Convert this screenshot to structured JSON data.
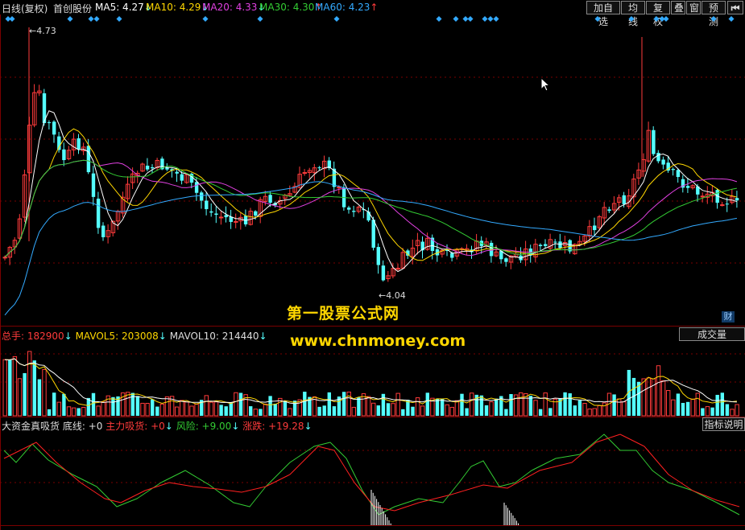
{
  "header": {
    "period": "日线(复权)",
    "stock_name": "首创股份",
    "ma": [
      {
        "label": "MA5: 4.27",
        "arrow": "↓",
        "color": "#ffffff"
      },
      {
        "label": "MA10: 4.29",
        "arrow": "↓",
        "color": "#ffd700"
      },
      {
        "label": "MA20: 4.33",
        "arrow": "↓",
        "color": "#e040e0"
      },
      {
        "label": "MA30: 4.30",
        "arrow": "↑",
        "color": "#33cc33"
      },
      {
        "label": "MA60: 4.23",
        "arrow": "↑",
        "color": "#33aaff"
      }
    ],
    "buttons": [
      "加自选",
      "均线",
      "复权",
      "叠",
      "窗",
      "预测"
    ],
    "nav_icon": "skip-back-icon"
  },
  "price": {
    "high_label": "4.73",
    "low_label": "4.04",
    "badge": "财"
  },
  "volume": {
    "total_label": "总手: 182900",
    "mavol5": "MAVOL5: 203008",
    "mavol10": "MAVOL10: 214440",
    "arrow": "↓",
    "button": "成交量"
  },
  "indicator": {
    "name": "大资金真吸货",
    "base": "底线: +0",
    "main": "主力吸货: +0",
    "risk": "风险: +9.00",
    "rise": "涨跌: +19.28",
    "arrow": "↓",
    "button": "指标说明"
  },
  "watermark": {
    "line1": "第一股票公式网",
    "line2": "www.chnmoney.com"
  },
  "colors": {
    "up": "#ff3b3b",
    "down": "#54ffff",
    "grid": "#7a0000",
    "ma5": "#ffffff",
    "ma10": "#ffd700",
    "ma20": "#e040e0",
    "ma30": "#33cc33",
    "ma60": "#33aaff",
    "diamond": "#33aaff"
  }
}
